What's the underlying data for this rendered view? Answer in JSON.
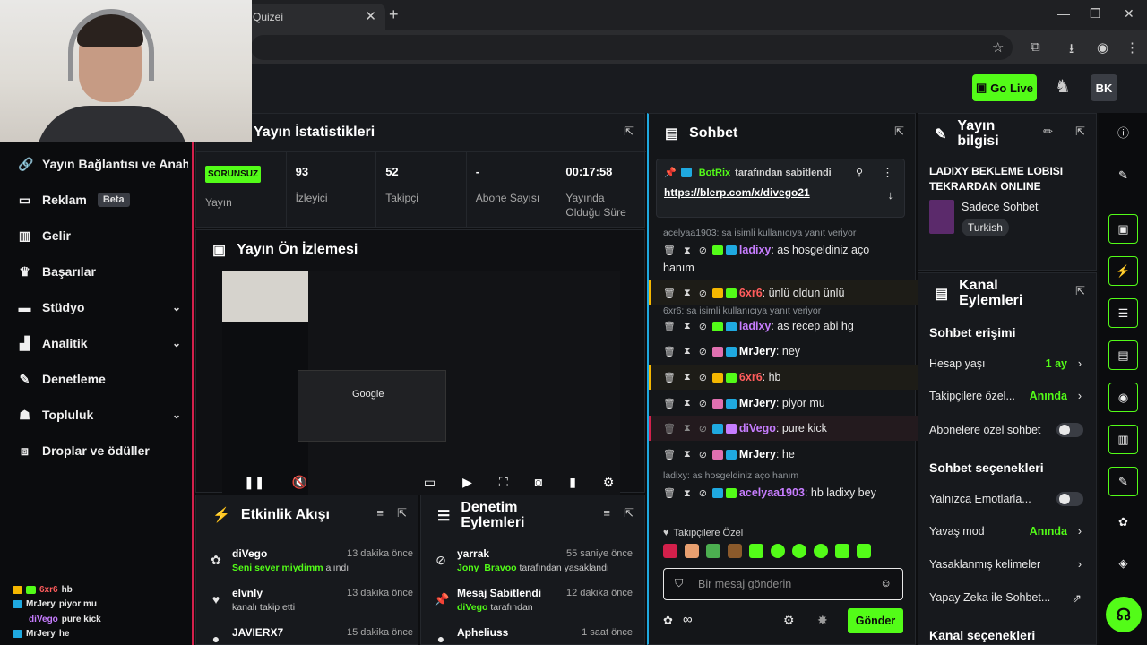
{
  "browser": {
    "tab_title": "Quizei",
    "tab_close": "✕",
    "new_tab": "+",
    "minimize": "—",
    "maximize": "❐",
    "close": "✕"
  },
  "topnav": {
    "go_live": "Go Live",
    "profile_initials": "BK"
  },
  "sidebar": {
    "items": [
      {
        "label": "Yayın Bağlantısı ve Anahtarı",
        "icon": "link-icon"
      },
      {
        "label": "Reklam",
        "badge": "Beta",
        "icon": "monitor-icon"
      },
      {
        "label": "Gelir",
        "icon": "bank-icon"
      },
      {
        "label": "Başarılar",
        "icon": "trophy-icon"
      },
      {
        "label": "Stüdyo",
        "icon": "studio-icon"
      },
      {
        "label": "Analitik",
        "icon": "chart-icon"
      },
      {
        "label": "Denetleme",
        "icon": "wrench-icon"
      },
      {
        "label": "Topluluk",
        "icon": "community-icon"
      },
      {
        "label": "Droplar ve ödüller",
        "icon": "gift-icon"
      }
    ],
    "mini_chat": [
      {
        "user": "6xr6",
        "text": "hb",
        "color": "#ff5c5c"
      },
      {
        "user": "MrJery",
        "text": "piyor mu",
        "color": "#ffffff"
      },
      {
        "user": "diVego",
        "text": "pure kick",
        "color": "#c77dff"
      },
      {
        "user": "MrJery",
        "text": "he",
        "color": "#ffffff"
      }
    ]
  },
  "stats": {
    "title": "Yayın İstatistikleri",
    "cells": [
      {
        "value": "SORUNSUZ",
        "label": "Yayın"
      },
      {
        "value": "93",
        "label": "İzleyici"
      },
      {
        "value": "52",
        "label": "Takipçi"
      },
      {
        "value": "-",
        "label": "Abone Sayısı"
      },
      {
        "value": "00:17:58",
        "label": "Yayında Olduğu Süre"
      }
    ]
  },
  "preview": {
    "title": "Yayın Ön İzlemesi",
    "google": "Google"
  },
  "activity": {
    "title": "Etkinlik Akışı",
    "items": [
      {
        "name": "diVego",
        "time": "13 dakika önce",
        "highlight": "Seni sever miydimm",
        "rest": " alındı"
      },
      {
        "name": "elvnly",
        "time": "13 dakika önce",
        "highlight": "",
        "rest": "kanalı takip etti"
      },
      {
        "name": "JAVIERX7",
        "time": "15 dakika önce",
        "highlight": "",
        "rest": ""
      }
    ]
  },
  "moderation": {
    "title": "Denetim Eylemleri",
    "items": [
      {
        "name": "yarrak",
        "time": "55 saniye önce",
        "highlight": "Jony_Bravoo",
        "rest": " tarafından yasaklandı"
      },
      {
        "name": "Mesaj Sabitlendi",
        "time": "12 dakika önce",
        "highlight": "diVego",
        "rest": " tarafından"
      },
      {
        "name": "Apheliuss",
        "time": "1 saat önce",
        "highlight": "",
        "rest": ""
      }
    ]
  },
  "chat": {
    "title": "Sohbet",
    "pinned_by": "BotRix",
    "pinned_suffix": "tarafından sabitlendi",
    "pinned_link": "https://blerp.com/x/divego21",
    "messages": [
      {
        "reply": "acelyaa1903: sa isimli kullanıcıya yanıt veriyor",
        "user": "ladixy",
        "color": "#c77dff",
        "text": ": as hosgeldiniz aço hanım"
      },
      {
        "reply": "",
        "user": "6xr6",
        "color": "#ff5c5c",
        "text": ": ünlü oldun ünlü"
      },
      {
        "reply": "6xr6: sa isimli kullanıcıya yanıt veriyor",
        "user": "ladixy",
        "color": "#c77dff",
        "text": ": as recep abi hg"
      },
      {
        "reply": "",
        "user": "MrJery",
        "color": "#ffffff",
        "text": ": ney"
      },
      {
        "reply": "",
        "user": "6xr6",
        "color": "#ff5c5c",
        "text": ": hb"
      },
      {
        "reply": "",
        "user": "MrJery",
        "color": "#ffffff",
        "text": ": piyor mu"
      },
      {
        "reply": "",
        "user": "diVego",
        "color": "#c77dff",
        "text": ": pure kick"
      },
      {
        "reply": "",
        "user": "MrJery",
        "color": "#ffffff",
        "text": ": he"
      },
      {
        "reply": "ladixy: as hosgeldiniz aço hanım",
        "user": "acelyaa1903",
        "color": "#c77dff",
        "text": ": hb ladixy bey"
      }
    ],
    "followers_only": "Takipçilere Özel",
    "input_placeholder": "Bir mesaj gönderin",
    "send": "Gönder"
  },
  "stream_info": {
    "title": "Yayın bilgisi",
    "stream_title": "LADIXY BEKLEME LOBISI TEKRARDAN ONLINE",
    "category": "Sadece Sohbet",
    "language": "Turkish"
  },
  "channel_actions": {
    "title": "Kanal Eylemleri",
    "chat_access": "Sohbet erişimi",
    "account_age_label": "Hesap yaşı",
    "account_age_value": "1 ay",
    "followers_label": "Takipçilere özel...",
    "followers_value": "Anında",
    "subs_label": "Abonelere özel sohbet",
    "chat_options": "Sohbet seçenekleri",
    "emotes_label": "Yalnızca Emotlarla...",
    "slow_label": "Yavaş mod",
    "slow_value": "Anında",
    "banned_words": "Yasaklanmış kelimeler",
    "ai_label": "Yapay Zeka ile Sohbet...",
    "channel_options": "Kanal seçenekleri"
  }
}
